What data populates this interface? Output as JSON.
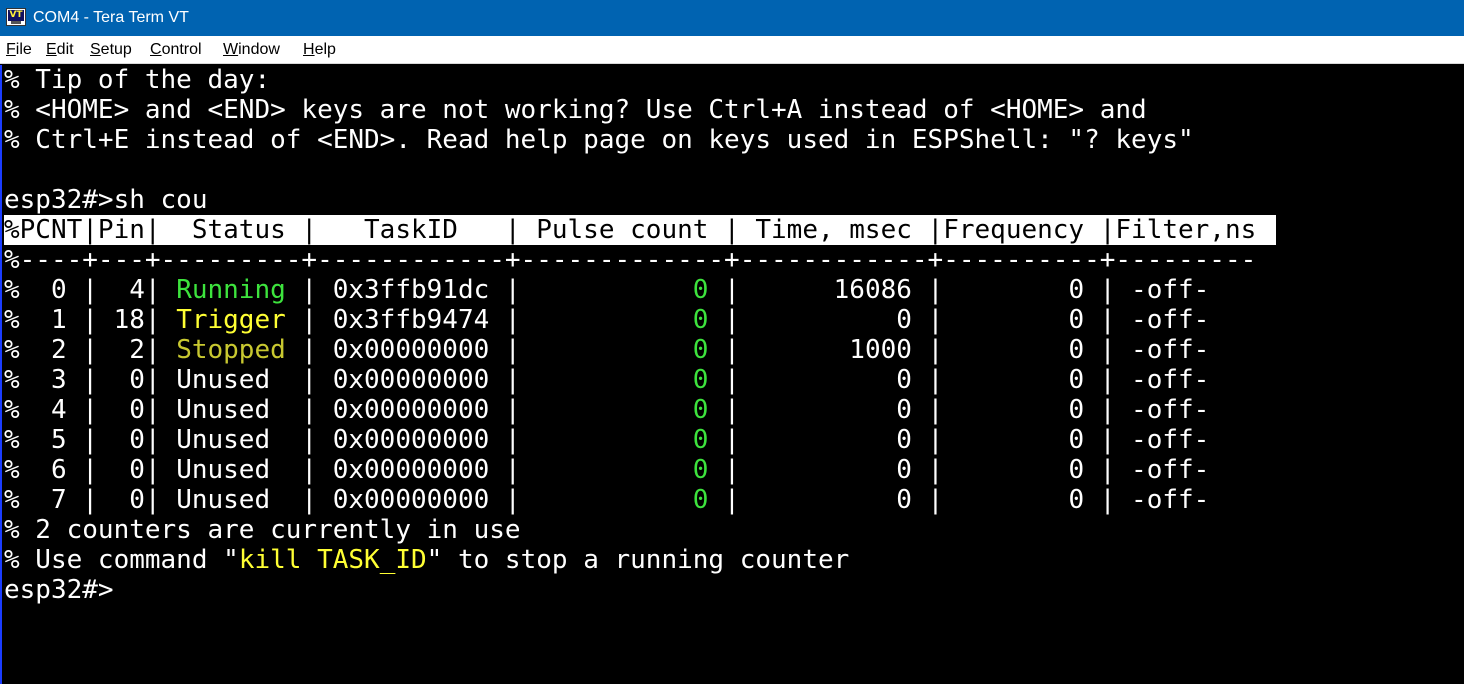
{
  "window": {
    "icon_label": "VT",
    "title": "COM4 - Tera Term VT"
  },
  "menu": [
    {
      "accel": "F",
      "rest": "ile"
    },
    {
      "accel": "E",
      "rest": "dit"
    },
    {
      "accel": "S",
      "rest": "etup"
    },
    {
      "accel": "C",
      "rest": "ontrol"
    },
    {
      "accel": "W",
      "rest": "indow"
    },
    {
      "accel": "H",
      "rest": "elp"
    }
  ],
  "terminal": {
    "tip_lines": [
      "% Tip of the day:",
      "% <HOME> and <END> keys are not working? Use Ctrl+A instead of <HOME> and",
      "% Ctrl+E instead of <END>. Read help page on keys used in ESPShell: \"? keys\""
    ],
    "command_line": "esp32#>sh cou",
    "table_header": "%PCNT|Pin|  Status |   TaskID   | Pulse count | Time, msec |Frequency |Filter,ns",
    "table_separator": "%----+---+---------+------------+-------------+------------+----------+---------",
    "rows": [
      {
        "prefix": "%  0 |  4| ",
        "status": "Running",
        "status_color": "#3de33d",
        "taskid": " | 0x3ffb91dc |",
        "pulse": "           0",
        "rest": " |      16086 |        0 | -off-"
      },
      {
        "prefix": "%  1 | 18| ",
        "status": "Trigger",
        "status_color": "#ffff33",
        "taskid": " | 0x3ffb9474 |",
        "pulse": "           0",
        "rest": " |          0 |        0 | -off-"
      },
      {
        "prefix": "%  2 |  2| ",
        "status": "Stopped",
        "status_color": "#c8c830",
        "taskid": " | 0x00000000 |",
        "pulse": "           0",
        "rest": " |       1000 |        0 | -off-"
      },
      {
        "prefix": "%  3 |  0| ",
        "status": "Unused ",
        "status_color": "#ffffff",
        "taskid": " | 0x00000000 |",
        "pulse": "           0",
        "rest": " |          0 |        0 | -off-"
      },
      {
        "prefix": "%  4 |  0| ",
        "status": "Unused ",
        "status_color": "#ffffff",
        "taskid": " | 0x00000000 |",
        "pulse": "           0",
        "rest": " |          0 |        0 | -off-"
      },
      {
        "prefix": "%  5 |  0| ",
        "status": "Unused ",
        "status_color": "#ffffff",
        "taskid": " | 0x00000000 |",
        "pulse": "           0",
        "rest": " |          0 |        0 | -off-"
      },
      {
        "prefix": "%  6 |  0| ",
        "status": "Unused ",
        "status_color": "#ffffff",
        "taskid": " | 0x00000000 |",
        "pulse": "           0",
        "rest": " |          0 |        0 | -off-"
      },
      {
        "prefix": "%  7 |  0| ",
        "status": "Unused ",
        "status_color": "#ffffff",
        "taskid": " | 0x00000000 |",
        "pulse": "           0",
        "rest": " |          0 |        0 | -off-"
      }
    ],
    "summary_line": "% 2 counters are currently in use",
    "usage_prefix": "% Use command \"",
    "usage_command": "kill TASK_ID",
    "usage_suffix": "\" to stop a running counter",
    "prompt": "esp32#>"
  }
}
